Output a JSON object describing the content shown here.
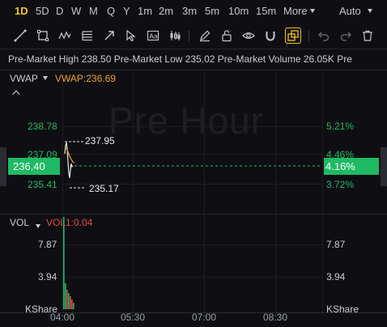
{
  "timeframes": {
    "items": [
      "1D",
      "5D",
      "D",
      "W",
      "M",
      "Q",
      "Y",
      "1m",
      "2m",
      "3m",
      "5m",
      "10m",
      "15m"
    ],
    "active": "1D",
    "more_label": "More",
    "auto_label": "Auto"
  },
  "stats": {
    "text": "Pre-Market High 238.50  Pre-Market Low 235.02  Pre-Market Volume 26.05K  Pre"
  },
  "main": {
    "indicator_label": "VWAP",
    "indicator_value": "VWAP:236.69",
    "watermark": "Pre Hour",
    "left_ticks": [
      "238.78",
      "237.09",
      "235.41"
    ],
    "right_ticks": [
      "5.21%",
      "4.46%",
      "3.72%"
    ],
    "current_price": "236.40",
    "current_pct": "4.16%",
    "high_label": "237.95",
    "low_label": "235.17"
  },
  "volume": {
    "label": "VOL",
    "indicator_value": "VOL1:0.04",
    "left_ticks": [
      "7.87",
      "3.94"
    ],
    "right_ticks": [
      "7.87",
      "3.94"
    ],
    "unit_left": "KShare",
    "unit_right": "KShare"
  },
  "x_axis": {
    "ticks": [
      "04:00",
      "05:30",
      "07:00",
      "08:30"
    ]
  },
  "colors": {
    "accent": "#f5c518",
    "up": "#1fba63",
    "down": "#e5484d",
    "vwap": "#f0a020",
    "price_line": "#e8e8e8"
  }
}
